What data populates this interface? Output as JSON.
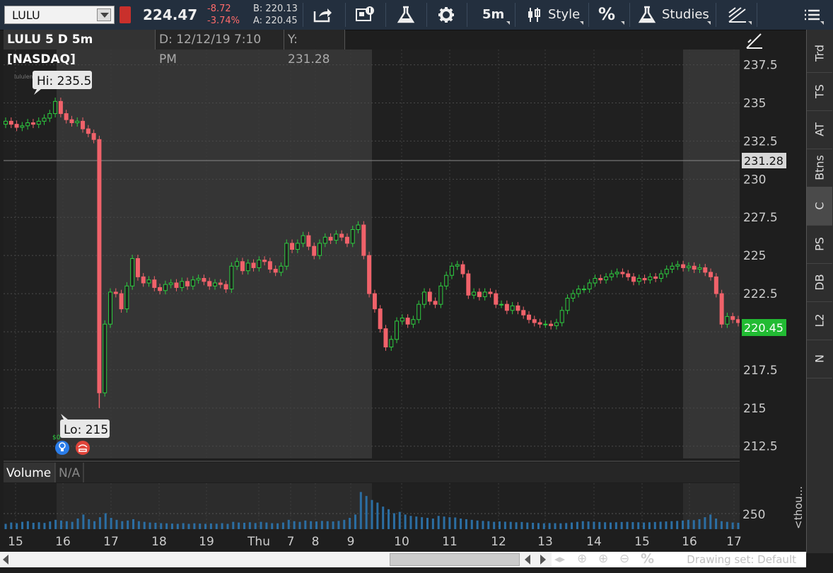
{
  "toolbar": {
    "symbol": "LULU",
    "last_price": "224.47",
    "net_change": "-8.72",
    "pct_change": "-3.74%",
    "bid": "B: 220.13",
    "ask": "A: 220.45",
    "timeframe": "5m",
    "style_label": "Style",
    "percent_label": "%",
    "studies_label": "Studies"
  },
  "chart_title": {
    "title": "LULU 5 D 5m [NASDAQ]",
    "cursor_date": "D: 12/12/19 7:10 PM",
    "cursor_y": "Y: 231.28"
  },
  "price_axis": {
    "ticks": [
      "237.5",
      "235",
      "232.5",
      "230",
      "227.5",
      "225",
      "222.5",
      "220",
      "217.5",
      "215",
      "212.5"
    ],
    "cursor_price_label": "231.28",
    "last_price_label": "220.45",
    "last_price_color": "#22bb33"
  },
  "annotations": {
    "high": "Hi: 235.5",
    "low": "Lo: 215",
    "watermark": "lululemon",
    "earnings_marker": "$0"
  },
  "volume": {
    "label": "Volume",
    "value": "N/A",
    "axis_tick": "250",
    "unit_label": "<thou..."
  },
  "time_axis": [
    "15",
    "16",
    "17",
    "18",
    "19",
    "Thu",
    "7",
    "8",
    "9",
    "10",
    "11",
    "12",
    "13",
    "14",
    "15",
    "16",
    "17"
  ],
  "side_tabs": [
    "Trd",
    "TS",
    "AT",
    "Btns",
    "C",
    "PS",
    "DB",
    "L2",
    "N"
  ],
  "active_side_tab": "C",
  "bottom": {
    "drawing_set": "Drawing set: Default"
  },
  "icons": [
    "share-icon",
    "news-icon",
    "flask-icon",
    "gear-icon",
    "style-icon",
    "studies-flask-icon",
    "drawing-icon",
    "menu-icon",
    "pen-icon",
    "lightbulb-icon",
    "phone-icon",
    "zoom-icon",
    "crosshair-icon"
  ],
  "chart_data": {
    "type": "candlestick",
    "instrument": "LULU",
    "aggregation": "5m",
    "ylim": [
      211.7,
      238.5
    ],
    "closes": [
      233.8,
      233.6,
      233.4,
      233.5,
      233.7,
      233.6,
      233.8,
      234.0,
      234.3,
      235.1,
      234.3,
      233.9,
      233.7,
      233.8,
      233.3,
      233.0,
      232.6,
      216.0,
      220.5,
      222.6,
      222.5,
      221.5,
      223.0,
      224.8,
      223.6,
      223.2,
      223.4,
      222.9,
      222.7,
      223.1,
      223.2,
      222.9,
      223.3,
      223.0,
      223.4,
      223.5,
      223.3,
      223.0,
      223.2,
      223.1,
      222.8,
      224.3,
      224.6,
      224.0,
      224.5,
      224.2,
      224.7,
      224.6,
      224.1,
      223.9,
      224.3,
      225.8,
      225.4,
      225.8,
      226.3,
      225.6,
      225.0,
      225.8,
      226.2,
      226.0,
      226.4,
      226.2,
      225.8,
      226.7,
      227.0,
      225.0,
      222.5,
      221.5,
      220.2,
      219.0,
      219.5,
      220.7,
      220.9,
      220.5,
      220.8,
      221.8,
      222.6,
      222.0,
      221.8,
      223.0,
      223.7,
      224.3,
      224.4,
      223.8,
      222.4,
      222.6,
      222.3,
      222.6,
      222.5,
      221.8,
      221.8,
      221.4,
      221.7,
      221.4,
      221.1,
      220.8,
      220.6,
      220.5,
      220.5,
      220.4,
      220.6,
      221.4,
      222.2,
      222.5,
      222.8,
      222.8,
      223.2,
      223.5,
      223.4,
      223.6,
      223.8,
      223.9,
      223.8,
      223.6,
      223.3,
      223.5,
      223.4,
      223.6,
      223.5,
      223.8,
      224.1,
      224.3,
      224.4,
      224.2,
      224.3,
      224.1,
      224.2,
      223.9,
      223.6,
      222.5,
      220.5,
      221.0,
      220.8,
      220.6
    ],
    "volume_ylim": [
      0,
      320
    ],
    "volumes": [
      40,
      50,
      45,
      55,
      60,
      48,
      52,
      47,
      58,
      70,
      65,
      60,
      55,
      80,
      110,
      75,
      60,
      90,
      120,
      85,
      70,
      60,
      65,
      75,
      60,
      55,
      50,
      48,
      45,
      44,
      42,
      40,
      45,
      40,
      44,
      42,
      40,
      43,
      41,
      45,
      40,
      55,
      50,
      48,
      52,
      46,
      55,
      50,
      45,
      44,
      50,
      70,
      60,
      55,
      65,
      60,
      58,
      62,
      60,
      58,
      62,
      70,
      85,
      110,
      280,
      250,
      220,
      200,
      170,
      150,
      120,
      130,
      110,
      100,
      95,
      90,
      85,
      80,
      100,
      95,
      90,
      88,
      80,
      75,
      70,
      65,
      62,
      60,
      55,
      58,
      56,
      55,
      52,
      54,
      50,
      48,
      46,
      44,
      46,
      45,
      44,
      46,
      50,
      55,
      60,
      58,
      56,
      54,
      52,
      50,
      52,
      54,
      55,
      53,
      52,
      50,
      52,
      54,
      56,
      58,
      60,
      62,
      65,
      70,
      68,
      75,
      90,
      110,
      80,
      60,
      55,
      50,
      48
    ]
  }
}
